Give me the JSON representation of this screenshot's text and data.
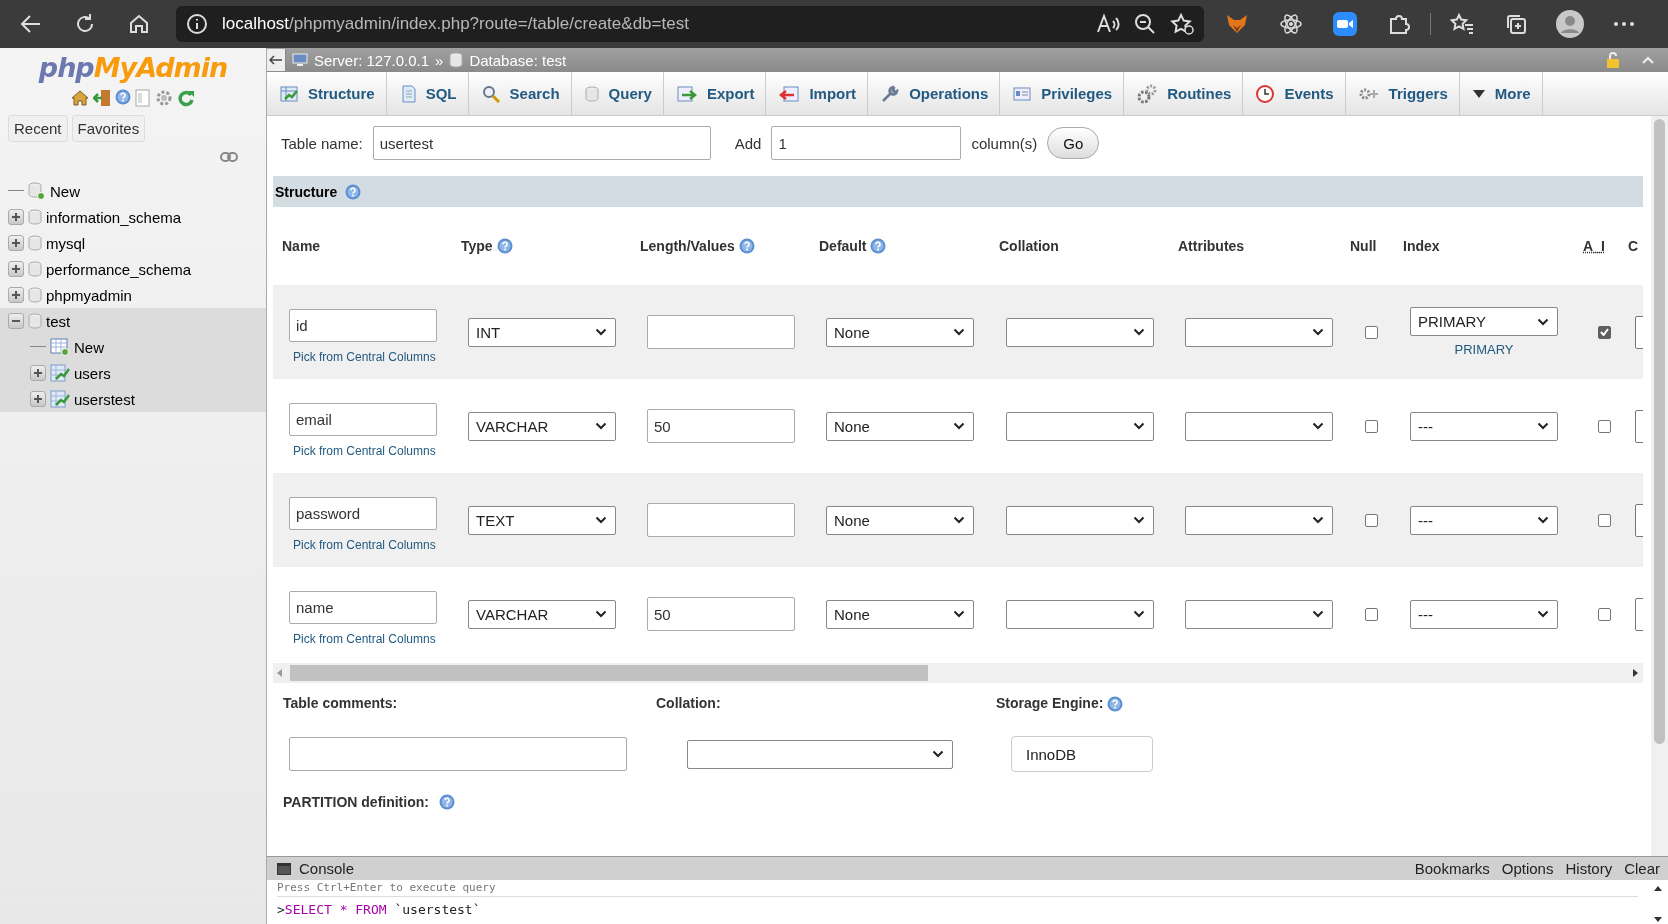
{
  "browser": {
    "url_host": "localhost",
    "url_path": "/phpmyadmin/index.php?route=/table/create&db=test"
  },
  "sidebar": {
    "logo": {
      "php": "php",
      "my_admin": "MyAdmin"
    },
    "nav_buttons": [
      "Recent",
      "Favorites"
    ],
    "tree": [
      {
        "label": "New",
        "kind": "new"
      },
      {
        "label": "information_schema",
        "kind": "database",
        "expanded": false,
        "selected": false
      },
      {
        "label": "mysql",
        "kind": "database",
        "expanded": false,
        "selected": false
      },
      {
        "label": "performance_schema",
        "kind": "database",
        "expanded": false,
        "selected": false
      },
      {
        "label": "phpmyadmin",
        "kind": "database",
        "expanded": false,
        "selected": false
      },
      {
        "label": "test",
        "kind": "database",
        "expanded": true,
        "selected": true,
        "children": [
          {
            "label": "New",
            "kind": "new_table"
          },
          {
            "label": "users",
            "kind": "table",
            "expanded": false
          },
          {
            "label": "userstest",
            "kind": "table",
            "expanded": false
          }
        ]
      }
    ]
  },
  "breadcrumb": {
    "server": "Server: 127.0.0.1",
    "separator": "»",
    "database": "Database: test"
  },
  "tabs": [
    {
      "label": "Structure",
      "selected": false
    },
    {
      "label": "SQL",
      "selected": false
    },
    {
      "label": "Search",
      "selected": false
    },
    {
      "label": "Query",
      "selected": false
    },
    {
      "label": "Export",
      "selected": false
    },
    {
      "label": "Import",
      "selected": false
    },
    {
      "label": "Operations",
      "selected": false
    },
    {
      "label": "Privileges",
      "selected": false
    },
    {
      "label": "Routines",
      "selected": false
    },
    {
      "label": "Events",
      "selected": false
    },
    {
      "label": "Triggers",
      "selected": false
    },
    {
      "label": "More",
      "selected": false
    }
  ],
  "table_name": {
    "label": "Table name:",
    "value": "usertest"
  },
  "add_columns": {
    "label": "Add",
    "value": "1",
    "suffix": "column(s)",
    "button": "Go"
  },
  "section_title": "Structure",
  "columns": [
    {
      "label": "Name",
      "help": false
    },
    {
      "label": "Type",
      "help": true
    },
    {
      "label": "Length/Values",
      "help": true
    },
    {
      "label": "Default",
      "help": true
    },
    {
      "label": "Collation",
      "help": false
    },
    {
      "label": "Attributes",
      "help": false
    },
    {
      "label": "Null",
      "help": false
    },
    {
      "label": "Index",
      "help": false
    },
    {
      "label": "A_I",
      "help": false
    },
    {
      "label": "C",
      "help": false
    }
  ],
  "fields": [
    {
      "name": "id",
      "pick_link": "Pick from Central Columns",
      "type": "INT",
      "default": "None",
      "null": false,
      "index": "PRIMARY",
      "index_note": "PRIMARY",
      "auto_increment": true
    },
    {
      "name": "email",
      "pick_link": "Pick from Central Columns",
      "type": "VARCHAR",
      "length": "50",
      "default": "None",
      "null": false,
      "index": "---",
      "auto_increment": false
    },
    {
      "name": "password",
      "pick_link": "Pick from Central Columns",
      "type": "TEXT",
      "default": "None",
      "null": false,
      "index": "---",
      "auto_increment": false
    },
    {
      "name": "name",
      "pick_link": "Pick from Central Columns",
      "type": "VARCHAR",
      "length": "50",
      "default": "None",
      "null": false,
      "index": "---",
      "auto_increment": false
    }
  ],
  "table_options": {
    "comments_label": "Table comments:",
    "collation_label": "Collation:",
    "engine_label": "Storage Engine:",
    "engine": "InnoDB",
    "partition_label": "PARTITION definition:"
  },
  "console": {
    "title": "Console",
    "links": [
      "Bookmarks",
      "Options",
      "History",
      "Clear"
    ],
    "hint": "Press Ctrl+Enter to execute query",
    "prompt": ">",
    "query": [
      {
        "text": "SELECT",
        "kind": "keyword"
      },
      {
        "text": "*",
        "kind": "operator"
      },
      {
        "text": "FROM",
        "kind": "keyword"
      },
      {
        "text": "`userstest`",
        "kind": "identifier"
      }
    ]
  }
}
